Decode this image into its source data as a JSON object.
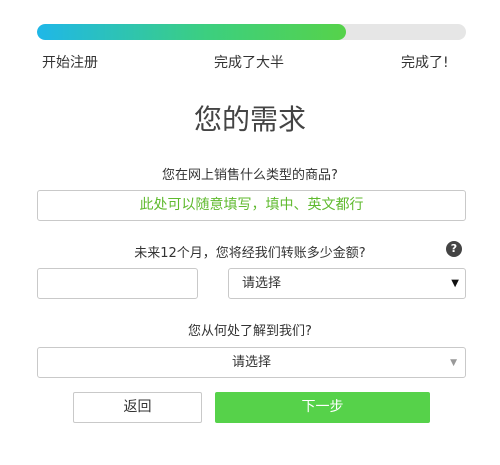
{
  "progress": {
    "value": 0.72
  },
  "steps": [
    "开始注册",
    "完成了大半",
    "完成了!"
  ],
  "page_title": "您的需求",
  "questions": {
    "product_type": "您在网上销售什么类型的商品?",
    "amount": "未来12个月，您将经我们转账多少金额?",
    "source": "您从何处了解到我们?"
  },
  "product_input": {
    "value": "此处可以随意填写，填中、英文都行"
  },
  "amount_select": {
    "selected": "请选择"
  },
  "source_select": {
    "selected": "请选择"
  },
  "help_icon": {
    "glyph": "?"
  },
  "buttons": {
    "back": "返回",
    "next": "下一步"
  },
  "colors": {
    "accent_green": "#56d24a",
    "progress_blue": "#1fb7e8",
    "hint_text": "#5fba2e"
  }
}
